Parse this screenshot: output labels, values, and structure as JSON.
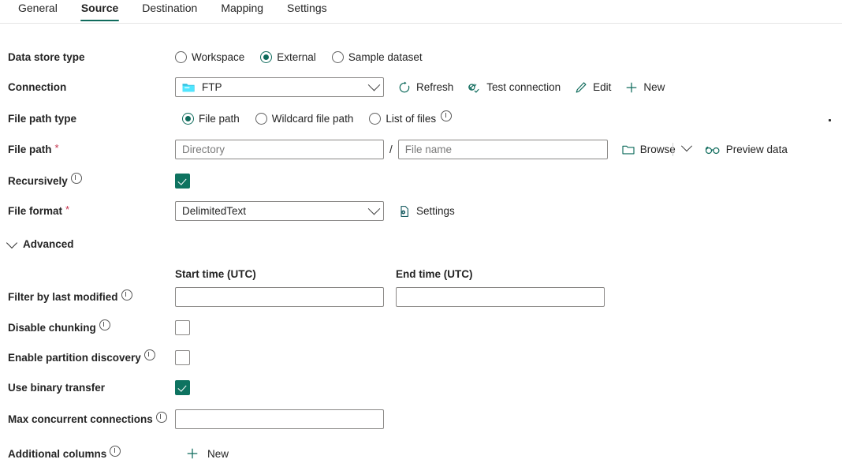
{
  "tabs": [
    {
      "label": "General",
      "active": false
    },
    {
      "label": "Source",
      "active": true
    },
    {
      "label": "Destination",
      "active": false
    },
    {
      "label": "Mapping",
      "active": false
    },
    {
      "label": "Settings",
      "active": false
    }
  ],
  "accent": "#0f6b5c",
  "required_marker": "*",
  "data_store_type": {
    "label": "Data store type",
    "options": [
      {
        "label": "Workspace",
        "selected": false
      },
      {
        "label": "External",
        "selected": true
      },
      {
        "label": "Sample dataset",
        "selected": false
      }
    ]
  },
  "connection": {
    "label": "Connection",
    "value": "FTP",
    "icon": "ftp-folder-icon",
    "commands": [
      {
        "label": "Refresh",
        "icon": "refresh-icon"
      },
      {
        "label": "Test connection",
        "icon": "plug-check-icon"
      },
      {
        "label": "Edit",
        "icon": "pencil-icon"
      },
      {
        "label": "New",
        "icon": "plus-icon"
      }
    ]
  },
  "file_path_type": {
    "label": "File path type",
    "options": [
      {
        "label": "File path",
        "selected": true,
        "info": false
      },
      {
        "label": "Wildcard file path",
        "selected": false,
        "info": false
      },
      {
        "label": "List of files",
        "selected": false,
        "info": true
      }
    ]
  },
  "file_path": {
    "label": "File path",
    "required": true,
    "directory_value": "",
    "directory_placeholder": "Directory",
    "separator": "/",
    "filename_value": "",
    "filename_placeholder": "File name",
    "browse_label": "Browse",
    "browse_icon": "folder-icon",
    "browse_chevron": "chevron-down-icon",
    "preview_label": "Preview data",
    "preview_icon": "glasses-icon"
  },
  "recursively": {
    "label": "Recursively",
    "info": true,
    "checked": true
  },
  "file_format": {
    "label": "File format",
    "required": true,
    "value": "DelimitedText",
    "settings_label": "Settings",
    "settings_icon": "file-settings-icon"
  },
  "advanced": {
    "label": "Advanced",
    "expanded": true,
    "chevron": "chevron-down-icon"
  },
  "time_filters": {
    "start_label": "Start time (UTC)",
    "start_value": "",
    "end_label": "End time (UTC)",
    "end_value": ""
  },
  "filter_by_last_modified": {
    "label": "Filter by last modified",
    "info": true
  },
  "disable_chunking": {
    "label": "Disable chunking",
    "info": true,
    "checked": false
  },
  "enable_partition_discovery": {
    "label": "Enable partition discovery",
    "info": true,
    "checked": false
  },
  "use_binary_transfer": {
    "label": "Use binary transfer",
    "info": false,
    "checked": true
  },
  "max_concurrent_connections": {
    "label": "Max concurrent connections",
    "info": true,
    "value": ""
  },
  "additional_columns": {
    "label": "Additional columns",
    "info": true,
    "new_label": "New",
    "new_icon": "plus-icon"
  }
}
